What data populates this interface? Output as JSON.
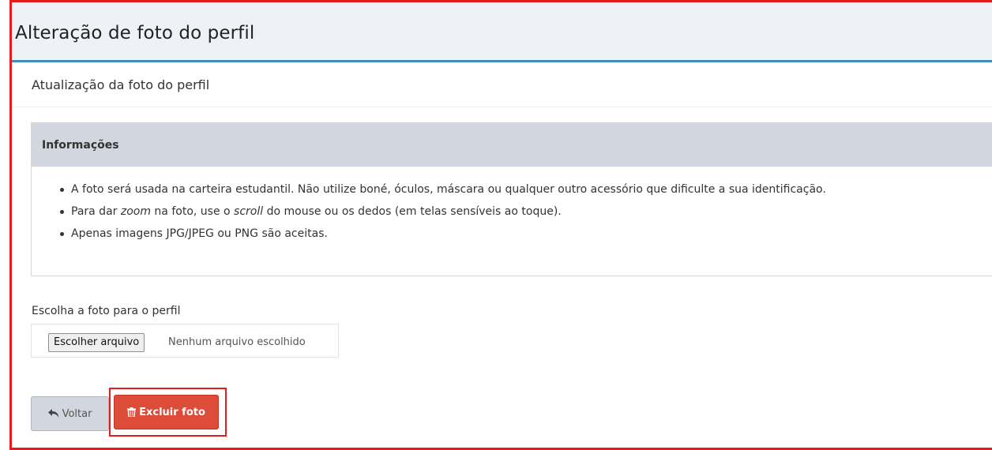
{
  "page": {
    "title": "Alteração de foto do perfil",
    "subtitle": "Atualização da foto do perfil"
  },
  "info": {
    "title": "Informações",
    "items": [
      {
        "before": "A foto será usada na carteira estudantil. Não utilize boné, óculos, máscara ou qualquer outro acessório que dificulte a sua identificação.",
        "em1": "",
        "mid": "",
        "em2": "",
        "after": ""
      },
      {
        "before": "Para dar ",
        "em1": "zoom",
        "mid": " na foto, use o ",
        "em2": "scroll",
        "after": " do mouse ou os dedos (em telas sensíveis ao toque)."
      },
      {
        "before": "Apenas imagens JPG/JPEG ou PNG são aceitas.",
        "em1": "",
        "mid": "",
        "em2": "",
        "after": ""
      }
    ]
  },
  "upload": {
    "label": "Escolha a foto para o perfil",
    "button_label": "Escolher arquivo",
    "status": "Nenhum arquivo escolhido"
  },
  "actions": {
    "back_label": "Voltar",
    "back_icon": "reply-icon",
    "delete_label": "Excluir foto",
    "delete_icon": "trash-icon"
  },
  "colors": {
    "header_border": "#3c8dbc",
    "delete_button": "#dd4b39",
    "highlight": "#e51c1c"
  }
}
